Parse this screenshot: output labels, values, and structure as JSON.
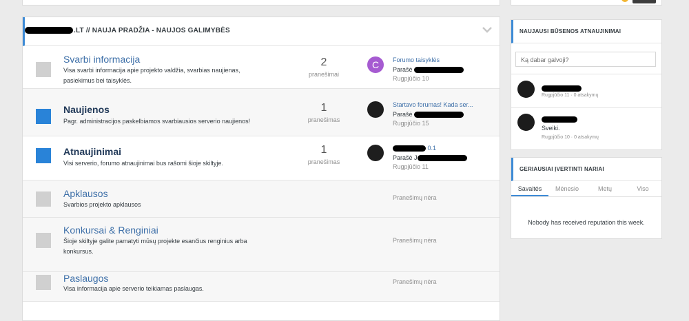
{
  "category": {
    "title": ".LT // NAUJA PRADŽIA - NAUJOS GALIMYBĖS",
    "forums": [
      {
        "title": "Svarbi informacija",
        "description": "Visa svarbi informacija apie projekto valdžia, svarbias naujienas, pasiekimus bei taisyklės.",
        "count": "2",
        "count_label": "pranešimai",
        "last_title": "Forumo taisyklės",
        "last_by": "Parašė",
        "last_date": "Rugpjūčio 10",
        "avatar_letter": "C"
      },
      {
        "title": "Naujienos",
        "description": "Pagr. administracijos paskelbiamos svarbiausios serverio naujienos!",
        "count": "1",
        "count_label": "pranešimas",
        "last_title": "Startavo forumas! Kada ser...",
        "last_by": "Parašė",
        "last_date": "Rugpjūčio 15"
      },
      {
        "title": "Atnaujinimai",
        "description": "Visi serverio, forumo atnaujinimai bus rašomi šioje skiltyje.",
        "count": "1",
        "count_label": "pranešimas",
        "last_title": "0.1",
        "last_by": "Parašė J",
        "last_date": "Rugpjūčio 11"
      },
      {
        "title": "Apklausos",
        "description": "Svarbios projekto apklausos",
        "empty": "Pranešimų nėra"
      },
      {
        "title": "Konkursai & Renginiai",
        "description": "Šioje skiltyje galite pamatyti mūsų projekte esančius renginius arba konkursus.",
        "empty": "Pranešimų nėra"
      },
      {
        "title": "Paslaugos",
        "description": "Visa informacija apie serverio teikiamas paslaugas.",
        "empty": "Pranešimų nėra"
      }
    ]
  },
  "status_widget": {
    "title": "NAUJAUSI BŪSENOS ATNAUJINIMAI",
    "placeholder": "Ką dabar galvoji?",
    "updates": [
      {
        "meta": "Rugpjūčio 11 · 0 atsakymų"
      },
      {
        "text": "Sveiki.",
        "meta": "Rugpjūčio 10 · 0 atsakymų"
      }
    ]
  },
  "rep_widget": {
    "title": "GERIAUSIAI ĮVERTINTI NARIAI",
    "tabs": [
      "Savaitės",
      "Mėnesio",
      "Metų",
      "Viso"
    ],
    "active_tab": "Savaitės",
    "empty": "Nobody has received reputation this week."
  },
  "colors": {
    "accent": "#3d8bd6",
    "unread_icon": "#2983d8",
    "read_icon": "#d0d0d0",
    "avatar_c": "#a65bd1"
  }
}
